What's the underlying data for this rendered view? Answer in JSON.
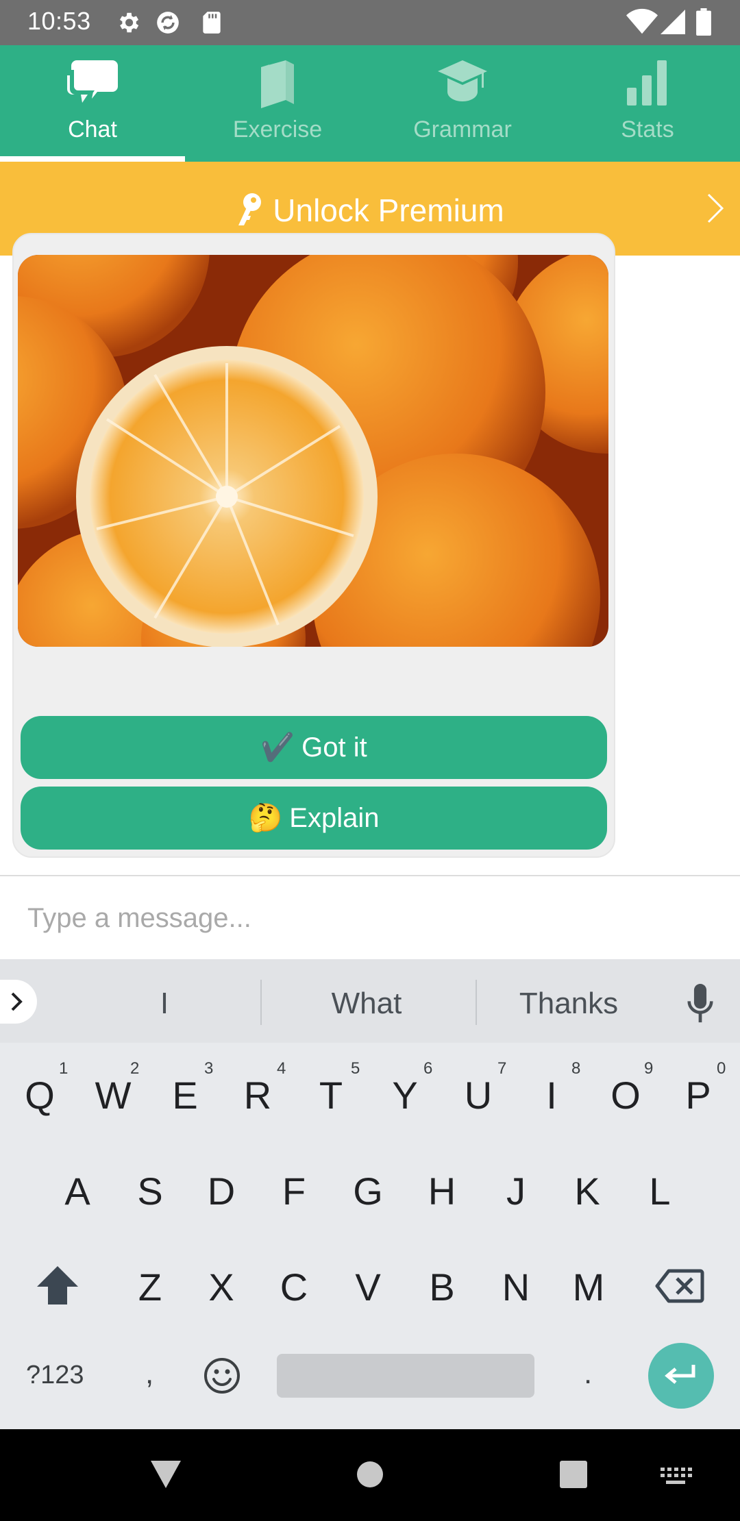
{
  "status_bar": {
    "time": "10:53",
    "left_icons": [
      "gear-icon",
      "sync-icon",
      "sd-card-icon"
    ],
    "right_icons": [
      "wifi-icon",
      "signal-icon",
      "battery-icon"
    ]
  },
  "tabs": [
    {
      "label": "Chat",
      "icon": "chat-bubbles-icon",
      "active": true
    },
    {
      "label": "Exercise",
      "icon": "book-icon",
      "active": false
    },
    {
      "label": "Grammar",
      "icon": "graduation-cap-icon",
      "active": false
    },
    {
      "label": "Stats",
      "icon": "bar-chart-icon",
      "active": false
    }
  ],
  "premium_banner": {
    "label": "Unlock Premium",
    "icon": "key-icon"
  },
  "chat": {
    "image_subject": "oranges",
    "buttons": [
      {
        "emoji": "✔️",
        "label": "Got it"
      },
      {
        "emoji": "🤔",
        "label": "Explain"
      }
    ]
  },
  "input": {
    "placeholder": "Type a message..."
  },
  "keyboard": {
    "suggestions": [
      "I",
      "What",
      "Thanks"
    ],
    "row1": [
      "Q",
      "W",
      "E",
      "R",
      "T",
      "Y",
      "U",
      "I",
      "O",
      "P"
    ],
    "row1_hints": [
      "1",
      "2",
      "3",
      "4",
      "5",
      "6",
      "7",
      "8",
      "9",
      "0"
    ],
    "row2": [
      "A",
      "S",
      "D",
      "F",
      "G",
      "H",
      "J",
      "K",
      "L"
    ],
    "row3": [
      "Z",
      "X",
      "C",
      "V",
      "B",
      "N",
      "M"
    ],
    "symbols_key": "?123",
    "comma_key": ",",
    "period_key": "."
  },
  "colors": {
    "primary": "#2eb086",
    "banner": "#f9be3b",
    "status_bar": "#6f6f6f"
  }
}
